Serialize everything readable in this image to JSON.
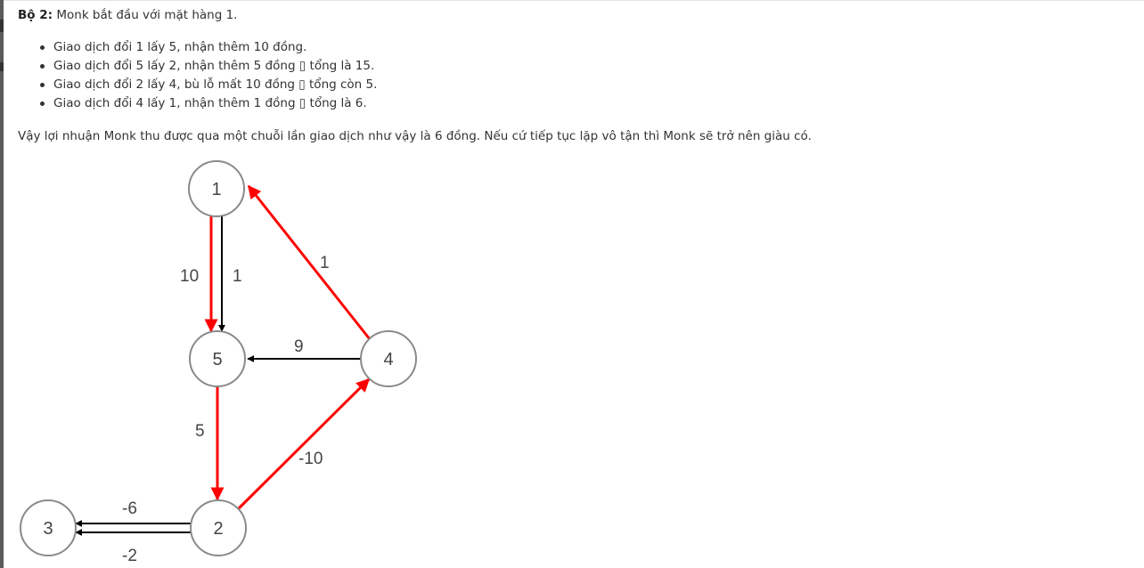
{
  "set": {
    "label": "Bộ 2:",
    "text": " Monk bắt đầu với mặt hàng 1."
  },
  "steps": [
    "Giao dịch đổi 1 lấy 5, nhận thêm 10 đồng.",
    "Giao dịch đổi 5 lấy 2, nhận thêm 5 đồng ▯ tổng là 15.",
    "Giao dịch đổi 2 lấy 4, bù lỗ mất 10 đồng ▯ tổng còn 5.",
    "Giao dịch đổi 4 lấy 1, nhận thêm 1 đồng ▯ tổng là 6."
  ],
  "conclusion": "Vậy lợi nhuận Monk thu được qua một chuỗi lần giao dịch như vậy là 6 đồng. Nếu cứ tiếp tục lặp vô tận thì Monk sẽ trở nên giàu có.",
  "graph": {
    "nodes": {
      "n1": "1",
      "n5": "5",
      "n4": "4",
      "n2": "2",
      "n3": "3"
    },
    "edges": {
      "e1_5_red": "10",
      "e1_5_black": "1",
      "e4_1": "1",
      "e4_5": "9",
      "e5_2": "5",
      "e2_4": "-10",
      "e2_3_top": "-6",
      "e2_3_bottom": "-2"
    },
    "colors": {
      "highlight": "#ff0000",
      "normal": "#000000",
      "node_stroke": "#8a8a8a"
    }
  }
}
